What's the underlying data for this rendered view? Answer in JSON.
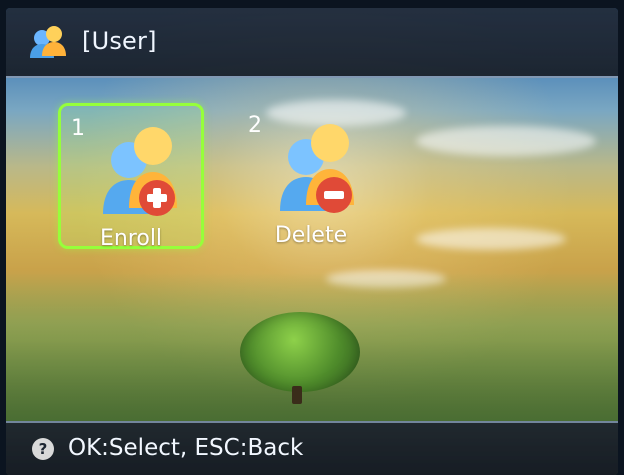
{
  "header": {
    "icon": "users-icon",
    "title": "[User]"
  },
  "menu": {
    "items": [
      {
        "number": "1",
        "label": "Enroll",
        "icon": "user-add-icon",
        "selected": true
      },
      {
        "number": "2",
        "label": "Delete",
        "icon": "user-remove-icon",
        "selected": false
      }
    ]
  },
  "footer": {
    "icon": "help-icon",
    "hint": "OK:Select, ESC:Back"
  }
}
